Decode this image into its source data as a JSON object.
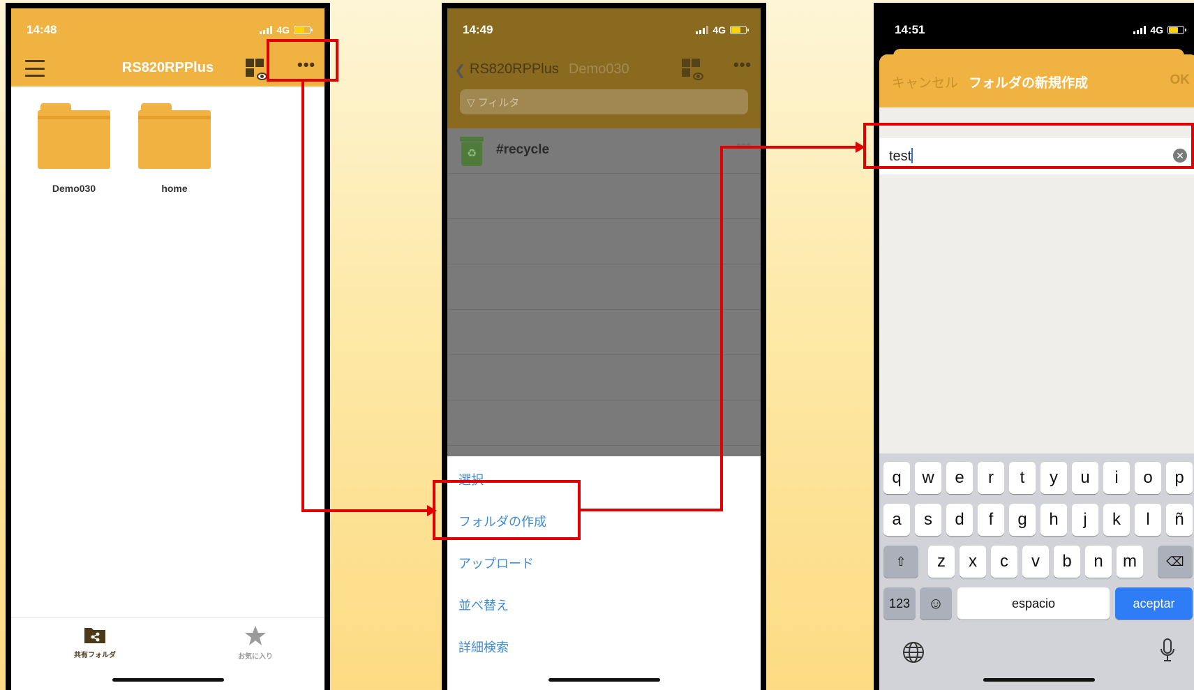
{
  "phone1": {
    "status": {
      "time": "14:48",
      "network": "4G"
    },
    "nav": {
      "title": "RS820RPPlus"
    },
    "folders": [
      {
        "name": "Demo030"
      },
      {
        "name": "home"
      }
    ],
    "tabbar": {
      "shared_label": "共有フォルダ",
      "favorites_label": "お気に入り"
    }
  },
  "phone2": {
    "status": {
      "time": "14:49",
      "network": "4G"
    },
    "nav": {
      "back_title": "RS820RPPlus",
      "current": "Demo030"
    },
    "filter_placeholder": "フィルタ",
    "rows": [
      {
        "name": "#recycle"
      }
    ],
    "menu": [
      "選択",
      "フォルダの作成",
      "アップロード",
      "並べ替え",
      "詳細検索"
    ]
  },
  "phone3": {
    "status": {
      "time": "14:51",
      "network": "4G"
    },
    "header": {
      "cancel": "キャンセル",
      "title": "フォルダの新規作成",
      "ok": "OK"
    },
    "field_value": "test",
    "keyboard": {
      "row1": [
        "q",
        "w",
        "e",
        "r",
        "t",
        "y",
        "u",
        "i",
        "o",
        "p"
      ],
      "row2": [
        "a",
        "s",
        "d",
        "f",
        "g",
        "h",
        "j",
        "k",
        "l",
        "ñ"
      ],
      "row3": [
        "z",
        "x",
        "c",
        "v",
        "b",
        "n",
        "m"
      ],
      "numbers": "123",
      "space": "espacio",
      "return": "aceptar"
    }
  },
  "colors": {
    "app_yellow": "#f0b341",
    "annotation_red": "#e00000",
    "link_blue": "#3f8cd6",
    "key_blue": "#2e7cf6"
  }
}
